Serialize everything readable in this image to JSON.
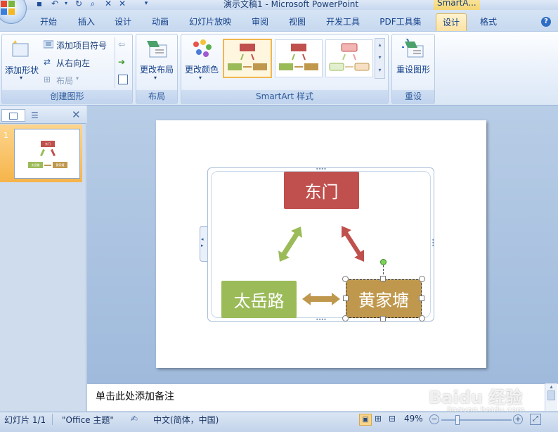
{
  "window": {
    "doc_title": "演示文稿1 - Microsoft PowerPoint",
    "context_tool_title": "SmartA..."
  },
  "tabs": [
    {
      "label": "开始"
    },
    {
      "label": "插入"
    },
    {
      "label": "设计"
    },
    {
      "label": "动画"
    },
    {
      "label": "幻灯片放映"
    },
    {
      "label": "审阅"
    },
    {
      "label": "视图"
    },
    {
      "label": "开发工具"
    },
    {
      "label": "PDF工具集"
    },
    {
      "label": "设计"
    },
    {
      "label": "格式"
    }
  ],
  "ribbon": {
    "create_group": {
      "label": "创建图形",
      "add_shape": "添加形状",
      "add_bullet": "添加项目符号",
      "right_to_left": "从右向左",
      "layout": "布局"
    },
    "layout_group": {
      "label": "布局",
      "change_layout": "更改布局"
    },
    "styles_group": {
      "label": "SmartArt 样式",
      "change_colors": "更改颜色"
    },
    "reset_group": {
      "label": "重设",
      "reset_graphic": "重设图形"
    }
  },
  "slides_pane": {
    "slide_number": "1"
  },
  "smartart": {
    "nodes": [
      {
        "text": "东门",
        "color": "#c0504d"
      },
      {
        "text": "太岳路",
        "color": "#9bbb59"
      },
      {
        "text": "黄家塘",
        "color": "#c0984d"
      }
    ],
    "thumb_nodes": [
      "东门",
      "太岳路",
      "黄家塘"
    ]
  },
  "notes": {
    "placeholder": "单击此处添加备注"
  },
  "statusbar": {
    "slide": "幻灯片 1/1",
    "theme": "\"Office 主题\"",
    "language": "中文(简体，中国)",
    "zoom": "49%"
  },
  "watermark": {
    "text": "Baidu 经验",
    "url": "jingyan.baidu.com"
  }
}
